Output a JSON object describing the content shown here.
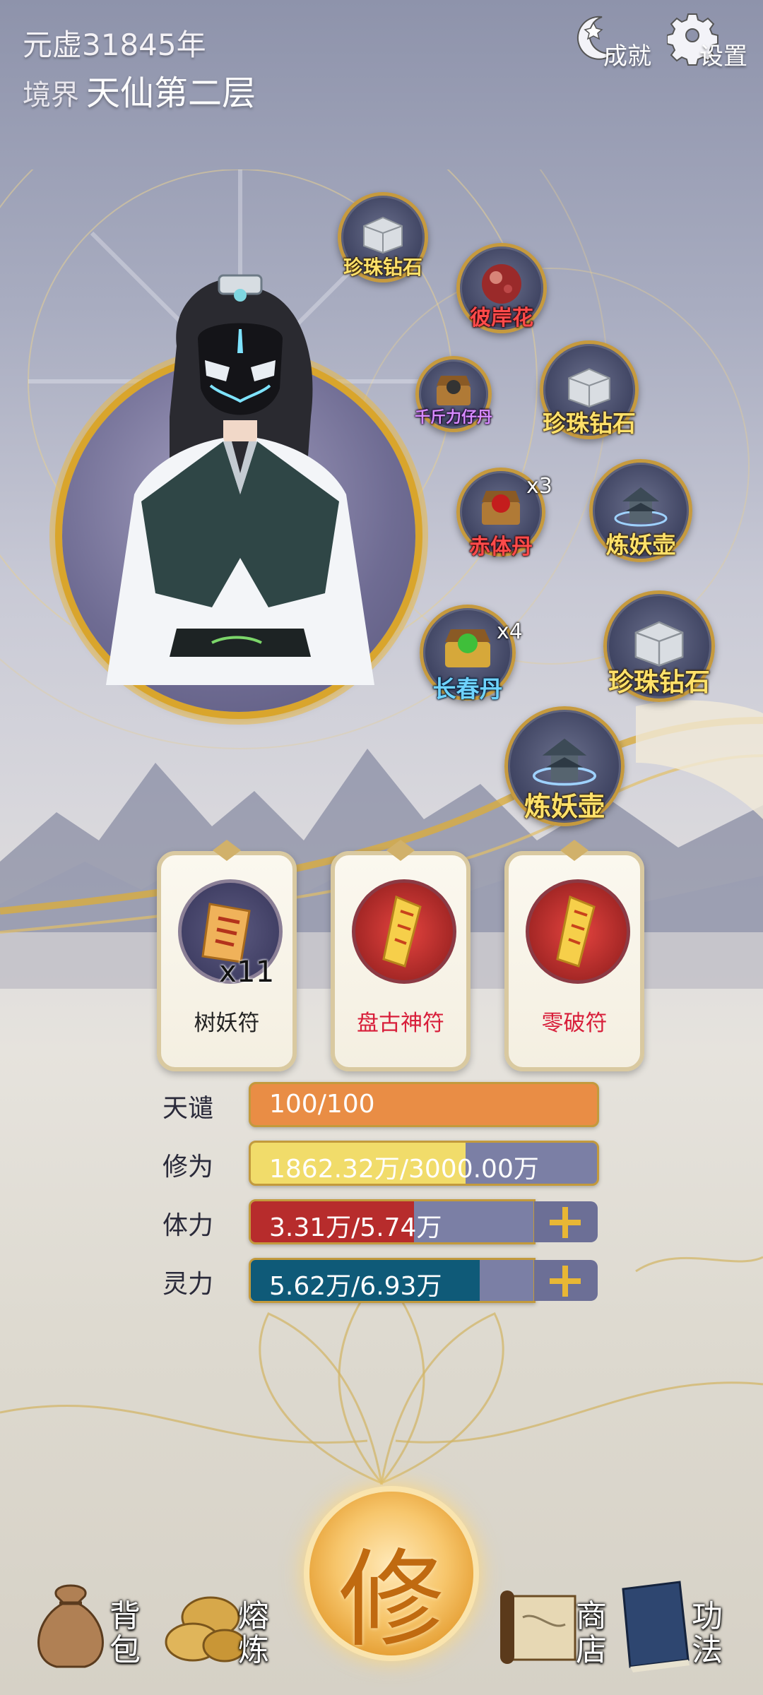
{
  "header": {
    "era": "元虚31845年",
    "realm_label": "境界",
    "realm_value": "天仙第二层",
    "achievements_label": "成就",
    "settings_label": "设置"
  },
  "loot": [
    {
      "name": "珍珠钻石",
      "qty": "",
      "color": "yellow",
      "icon": "pearl-diamond-chest-icon"
    },
    {
      "name": "彼岸花",
      "qty": "",
      "color": "red",
      "icon": "red-orb-icon"
    },
    {
      "name": "千斤力仔丹",
      "qty": "",
      "color": "purple",
      "icon": "dark-pill-chest-icon"
    },
    {
      "name": "珍珠钻石",
      "qty": "",
      "color": "yellow",
      "icon": "pearl-diamond-chest-icon"
    },
    {
      "name": "赤体丹",
      "qty": "x3",
      "color": "red",
      "icon": "red-pill-chest-icon"
    },
    {
      "name": "炼妖壶",
      "qty": "",
      "color": "yellow",
      "icon": "demon-pot-pagoda-icon"
    },
    {
      "name": "长春丹",
      "qty": "x4",
      "color": "blue",
      "icon": "green-pill-chest-icon"
    },
    {
      "name": "珍珠钻石",
      "qty": "",
      "color": "yellow",
      "icon": "pearl-diamond-chest-icon"
    },
    {
      "name": "炼妖壶",
      "qty": "",
      "color": "yellow",
      "icon": "demon-pot-pagoda-icon"
    }
  ],
  "talismans": [
    {
      "name": "树妖符",
      "qty": "x11",
      "name_color": "#222222"
    },
    {
      "name": "盘古神符",
      "qty": "",
      "name_color": "#d81e3a"
    },
    {
      "name": "零破符",
      "qty": "",
      "name_color": "#d81e3a"
    }
  ],
  "stats": [
    {
      "label": "天谴",
      "value": "100/100",
      "fill": 1.0,
      "color": "#e98d45",
      "has_plus": false
    },
    {
      "label": "修为",
      "value": "1862.32万/3000.00万",
      "fill": 0.62,
      "color": "#f1dc6a",
      "has_plus": false
    },
    {
      "label": "体力",
      "value": "3.31万/5.74万",
      "fill": 0.577,
      "color": "#b72c2c",
      "has_plus": true
    },
    {
      "label": "灵力",
      "value": "5.62万/6.93万",
      "fill": 0.811,
      "color": "#0f5a78",
      "has_plus": true
    }
  ],
  "nav": {
    "bag_top": "背",
    "bag_bottom": "包",
    "smelt_top": "熔",
    "smelt_bottom": "炼",
    "cultivate": "修",
    "shop_top": "商",
    "shop_bottom": "店",
    "skills_top": "功",
    "skills_bottom": "法"
  }
}
